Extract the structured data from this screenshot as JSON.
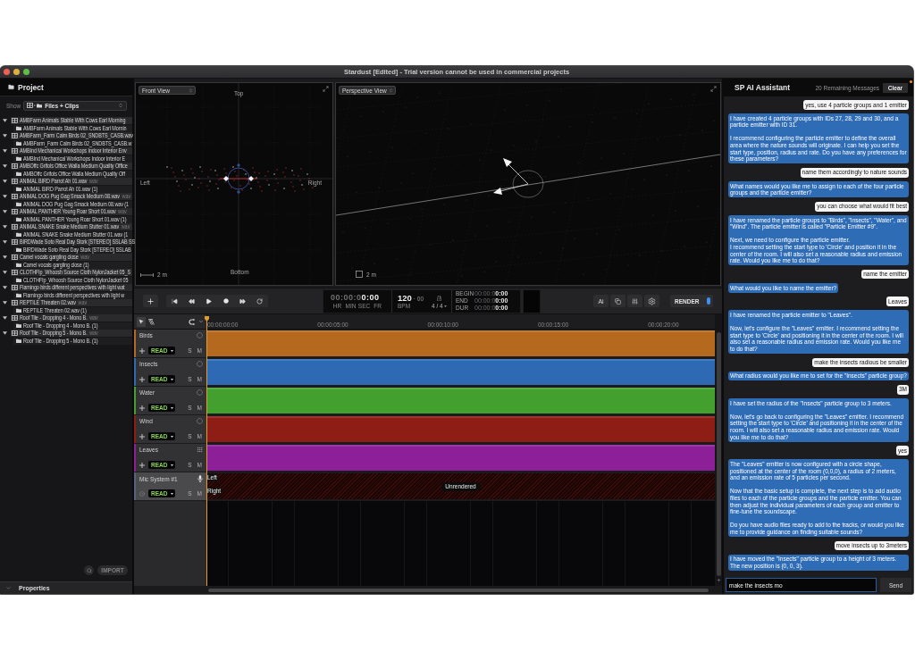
{
  "window": {
    "title": "Stardust [Edited] - Trial version cannot be used in commercial projects"
  },
  "project": {
    "title": "Project",
    "show_label": "Show",
    "show_value": "Files + Clips",
    "files": [
      {
        "name": "AMBFarm Animals Stable With Cows Earl Morning",
        "expanded": true,
        "children": [
          {
            "name": "AMBFarm Animals Stable With Cows Earl Mornin"
          }
        ]
      },
      {
        "name": "AMBFarm_Farm Calm Birds 02_SNDBTS_CASB.wav",
        "expanded": true,
        "children": [
          {
            "name": "AMBFarm_Farm Calm Birds 02_SNDBTS_CASB.w"
          }
        ]
      },
      {
        "name": "AMBInd Mechanical Workshops Indoor Interior Env",
        "expanded": true,
        "children": [
          {
            "name": "AMBInd Mechanical Workshops Indoor Interior E"
          }
        ]
      },
      {
        "name": "AMBOffc Grifols Office Walla Medium Quality Office",
        "expanded": true,
        "children": [
          {
            "name": "AMBOffc Grifols Office Walla Medium Quality Off"
          }
        ]
      },
      {
        "name": "ANIMAL BIRD Parrot Ah 01.wav",
        "type": "wav",
        "expanded": true,
        "children": [
          {
            "name": "ANIMAL BIRD Parrot Ah 01.wav (1)"
          }
        ]
      },
      {
        "name": "ANIMAL DOG Pug Gag Smack Medium 08.wav",
        "type": "wav",
        "expanded": true,
        "children": [
          {
            "name": "ANIMAL DOG Pug Gag Smack Medium 08.wav (1"
          }
        ]
      },
      {
        "name": "ANIMAL PANTHER Young Roar Short 01.wav",
        "type": "wav",
        "expanded": true,
        "children": [
          {
            "name": "ANIMAL PANTHER Young Roar Short 01.wav (1)"
          }
        ]
      },
      {
        "name": "ANIMAL SNAKE Snake Medium Stutter 01.wav",
        "type": "wav",
        "expanded": true,
        "children": [
          {
            "name": "ANIMAL SNAKE Snake Medium Stutter 01.wav (1"
          }
        ]
      },
      {
        "name": "BIRDWade Soto Real Day Stork [STEREO] SSLAB SS",
        "expanded": true,
        "children": [
          {
            "name": "BIRDWade Soto Real Day Stork [STEREO] SSLAB"
          }
        ]
      },
      {
        "name": "Camel vocals gargling close",
        "type": "wav",
        "expanded": true,
        "children": [
          {
            "name": "Camel vocals gargling close (1)"
          }
        ]
      },
      {
        "name": "CLOTHFlp_Whoosh Source Cloth NylonJacket 05_S",
        "expanded": true,
        "children": [
          {
            "name": "CLOTHFlp_Whoosh Source Cloth NylonJacket 05"
          }
        ]
      },
      {
        "name": "Flamingo birds different perspectives with light wat",
        "expanded": true,
        "children": [
          {
            "name": "Flamingo birds different perspectives with light w"
          }
        ]
      },
      {
        "name": "REPTILE Threaten 02.wav",
        "type": "wav",
        "expanded": true,
        "children": [
          {
            "name": "REPTILE Threaten 02.wav (1)"
          }
        ]
      },
      {
        "name": "Roof Tile - Dropping 4 - Mono B.",
        "type": "wav",
        "expanded": true,
        "children": [
          {
            "name": "Roof Tile - Dropping 4 - Mono B. (1)"
          }
        ]
      },
      {
        "name": "Roof Tile - Dropping 5 - Mono B.",
        "type": "wav",
        "expanded": true,
        "children": [
          {
            "name": "Roof Tile - Dropping 5 - Mono B. (1)"
          }
        ]
      }
    ],
    "import_button": "IMPORT",
    "properties_title": "Properties"
  },
  "viewports": [
    {
      "kind": "front",
      "view": "Front View",
      "axis_labels": {
        "top": "Top",
        "left": "Left",
        "right": "Right",
        "bottom": "Bottom"
      },
      "scale": "2 m"
    },
    {
      "kind": "perspective",
      "view": "Perspective View",
      "scale": "2 m"
    }
  ],
  "transport": {
    "timecode": "00:00:0**0:00**",
    "units": [
      "HR",
      "MIN",
      "SEC",
      "FR"
    ],
    "tempo": "120",
    "tempo_decimals": "· 00",
    "tempo_label": "BPM",
    "meter": "4 / 4",
    "range": [
      {
        "label": "BEGIN",
        "value": "00:00:0**0:00**"
      },
      {
        "label": "END",
        "value": "00:00:0**0:00**"
      },
      {
        "label": "DUR",
        "value": "00:00:0**0:00**"
      }
    ],
    "ai_button": "Ai",
    "render_button": "RENDER"
  },
  "timeline": {
    "ticks": [
      "00:00:00:00",
      "00:00:05:00",
      "00:00:10:00",
      "00:00:15:00",
      "00:00:20:00"
    ]
  },
  "tracks": [
    {
      "name": "Birds",
      "kind": "particle-group",
      "color": "#b4691f",
      "selected": false,
      "mode": "READ",
      "solo": "S",
      "mute": "M"
    },
    {
      "name": "Insects",
      "kind": "particle-group",
      "color": "#2e6ab3",
      "selected": false,
      "mode": "READ",
      "solo": "S",
      "mute": "M"
    },
    {
      "name": "Water",
      "kind": "particle-group",
      "color": "#44a02e",
      "selected": false,
      "mode": "READ",
      "solo": "S",
      "mute": "M"
    },
    {
      "name": "Wind",
      "kind": "particle-group",
      "color": "#8e1d15",
      "selected": false,
      "mode": "READ",
      "solo": "S",
      "mute": "M"
    },
    {
      "name": "Leaves",
      "kind": "emitter",
      "color": "#8d1f98",
      "selected": false,
      "mode": "READ",
      "solo": "S",
      "mute": "M"
    },
    {
      "name": "Mic System #1",
      "kind": "mic",
      "selected": true,
      "mode": "READ",
      "solo": "S",
      "mute": "M",
      "channels": [
        "Left",
        "Right"
      ],
      "status": "Unrendered"
    }
  ],
  "assistant": {
    "title": "SP AI Assistant",
    "remaining": "20 Remaining Messages",
    "clear_button": "Clear",
    "messages": [
      {
        "kind": "user",
        "text": "yes, use 4 particle groups and 1 emitter"
      },
      {
        "kind": "assistant",
        "text": "I have created 4 particle groups with IDs 27, 28, 29 and 30, and a particle emitter with ID 31.\n\nI recommend configuring the particle emitter to define the overall area where the nature sounds will originate. I can help you set the start type, position, radius and rate. Do you have any preferences for these parameters?"
      },
      {
        "kind": "user",
        "text": "name them accordingly to nature sounds"
      },
      {
        "kind": "assistant",
        "text": "What names would you like me to assign to each of the four particle groups and the particle emitter?"
      },
      {
        "kind": "user",
        "text": "you can choose what would fit best"
      },
      {
        "kind": "assistant",
        "text": "I have renamed the particle groups to \"Birds\", \"Insects\", \"Water\", and \"Wind\". The particle emitter is called \"Particle Emitter #9\".\n\nNext, we need to configure the particle emitter.\nI recommend setting the start type to 'Circle' and position it in the center of the room. I will also set a reasonable radius and emission rate. Would you like me to do that?"
      },
      {
        "kind": "user",
        "text": "name the emitter"
      },
      {
        "kind": "assistant",
        "text": "What would you like to name the emitter?"
      },
      {
        "kind": "user",
        "text": "Leaves"
      },
      {
        "kind": "assistant",
        "text": "I have renamed the particle emitter to \"Leaves\".\n\nNow, let's configure the \"Leaves\" emitter. I recommend setting the start type to 'Circle' and positioning it in the center of the room. I will also set a reasonable radius and emission rate. Would you like me to do that?"
      },
      {
        "kind": "user",
        "text": "make the insects radious be smaller"
      },
      {
        "kind": "assistant",
        "text": "What radius would you like me to set for the \"Insects\" particle group?"
      },
      {
        "kind": "user",
        "text": "3M"
      },
      {
        "kind": "assistant",
        "text": "I have set the radius of the \"Insects\" particle group to 3 meters.\n\nNow, let's go back to configuring the \"Leaves\" emitter. I recommend setting the start type to 'Circle' and positioning it in the center of the room. I will also set a reasonable radius and emission rate. Would you like me to do that?"
      },
      {
        "kind": "user",
        "text": "yes"
      },
      {
        "kind": "assistant",
        "text": "The \"Leaves\" emitter is now configured with a circle shape, positioned at the center of the room (0,0,0), a radius of 2 meters, and an emission rate of 5 particles per second.\n\nNow that the basic setup is complete, the next step is to add audio files to each of the particle groups and the particle emitter. You can then adjust the individual parameters of each group and emitter to fine-tune the soundscape.\n\nDo you have audio files ready to add to the tracks, or would you like me to provide guidance on finding suitable sounds?"
      },
      {
        "kind": "user",
        "text": "move insects up to 3meters"
      },
      {
        "kind": "assistant",
        "text": "I have moved the \"Insects\" particle group to a height of 3 meters. The new position is (0, 0, 3)."
      }
    ],
    "input": {
      "value": "make the insects mo"
    },
    "send_button": "Send"
  }
}
